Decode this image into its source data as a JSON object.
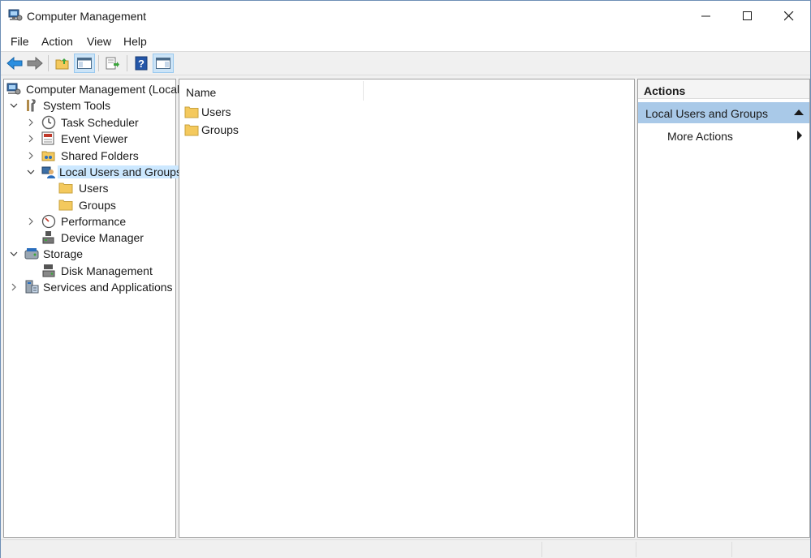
{
  "window": {
    "title": "Computer Management"
  },
  "menu": [
    "File",
    "Action",
    "View",
    "Help"
  ],
  "toolbar": {
    "buttons": [
      "back-arrow-icon",
      "forward-arrow-icon",
      "up-folder-icon",
      "show-hide-tree-icon",
      "export-list-icon",
      "help-icon",
      "show-hide-action-pane-icon"
    ]
  },
  "tree": {
    "root": "Computer Management (Local)",
    "system_tools": "System Tools",
    "task_scheduler": "Task Scheduler",
    "event_viewer": "Event Viewer",
    "shared_folders": "Shared Folders",
    "local_users_groups": "Local Users and Groups",
    "users": "Users",
    "groups": "Groups",
    "performance": "Performance",
    "device_manager": "Device Manager",
    "storage": "Storage",
    "disk_management": "Disk Management",
    "services_apps": "Services and Applications"
  },
  "list": {
    "column_name": "Name",
    "rows": [
      "Users",
      "Groups"
    ]
  },
  "actions": {
    "header": "Actions",
    "group": "Local Users and Groups",
    "more": "More Actions"
  },
  "colors": {
    "selection": "#cce8ff",
    "action_group_bg": "#a9c9e8",
    "folder": "#f4c95d",
    "back_arrow": "#1e88e5"
  }
}
